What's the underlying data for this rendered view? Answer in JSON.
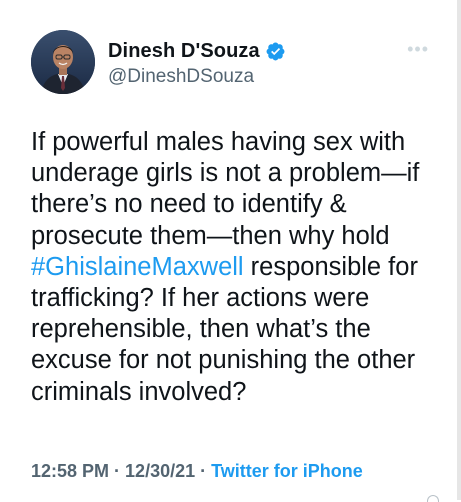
{
  "author": {
    "name": "Dinesh D'Souza",
    "handle": "@DineshDSouza",
    "avatar_icon": "profile-photo",
    "verified_icon": "verified-badge-icon",
    "verified_color": "#1d9bf0"
  },
  "more_icon": "more-options-icon",
  "tweet": {
    "text_before": "If powerful males having sex with underage girls is not a problem—if there’s no need to identify & prosecute them—then why hold ",
    "hashtag": "#GhislaineMaxwell",
    "text_after": " responsible for trafficking? If her actions were reprehensible, then what’s the excuse for not punishing the other criminals involved?"
  },
  "meta": {
    "time": "12:58 PM",
    "separator": " · ",
    "date": "12/30/21",
    "source": "Twitter for iPhone"
  },
  "colors": {
    "text": "#0f1419",
    "secondary": "#536471",
    "link": "#1d9bf0"
  }
}
